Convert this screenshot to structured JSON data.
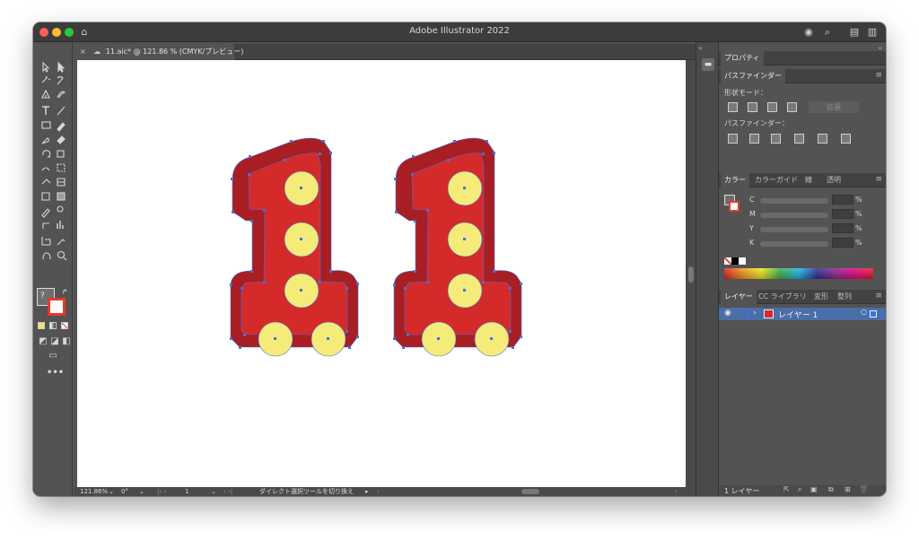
{
  "app_title": "Adobe Illustrator 2022",
  "document_tab": {
    "close": "×",
    "label": "11.aic* @ 121.86 % (CMYK/プレビュー)"
  },
  "status": {
    "zoom": "121.86%",
    "rotation": "0°",
    "artboard": "1",
    "tool_message": "ダイレクト選択ツールを切り換え"
  },
  "panels": {
    "properties_tab": "プロパティ",
    "pathfinder_tab": "パスファインダー",
    "shape_modes_label": "形状モード：",
    "expand_button": "拡張",
    "pathfinders_label": "パスファインダー：",
    "color_tabs": [
      "カラー",
      "カラーガイド",
      "線",
      "透明"
    ],
    "cmyk_channels": [
      {
        "label": "C",
        "unit": "%"
      },
      {
        "label": "M",
        "unit": "%"
      },
      {
        "label": "Y",
        "unit": "%"
      },
      {
        "label": "K",
        "unit": "%"
      }
    ],
    "layer_tabs": [
      "レイヤー",
      "CC ライブラリ",
      "変形",
      "整列"
    ],
    "layer_name": "レイヤー 1",
    "layer_count": "1 レイヤー"
  },
  "artwork": {
    "glyph": "1",
    "outer_color": "#a81e22",
    "inner_color": "#d52a2a",
    "bulb_color": "#f5eb79",
    "selection_color": "#4a6fd8"
  },
  "colors": {
    "ui_bg": "#535353",
    "ui_dark": "#3c3c3c",
    "close_light": "#fe5f57",
    "min_light": "#febc2e",
    "max_light": "#28c840",
    "layer_highlight": "#4b6ea8"
  }
}
